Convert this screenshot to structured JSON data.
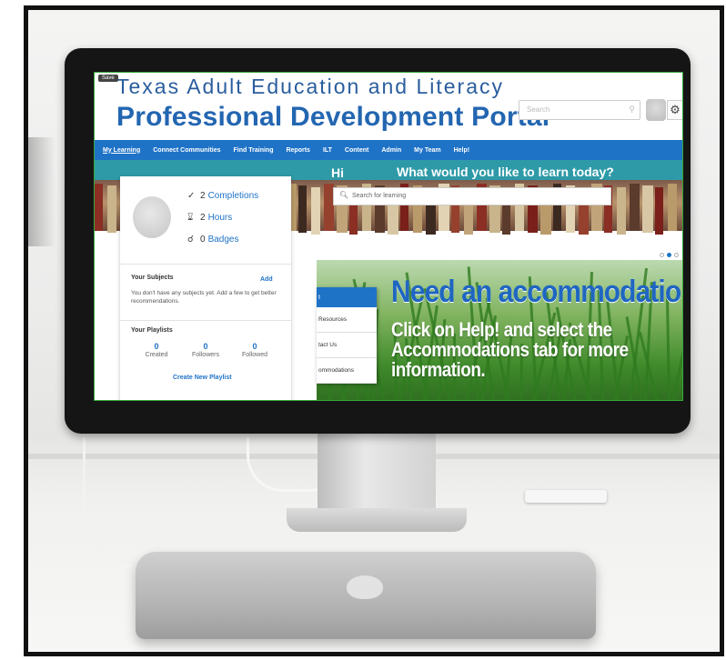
{
  "header": {
    "save_badge": "Save",
    "title_line1": "Texas Adult Education and Literacy",
    "title_line2": "Professional Development Portal",
    "search_placeholder": "Search"
  },
  "nav": {
    "items": [
      "My Learning",
      "Connect Communities",
      "Find Training",
      "Reports",
      "ILT",
      "Content",
      "Admin",
      "My Team",
      "Help!"
    ],
    "active_index": 0
  },
  "hero": {
    "greeting": "Hi",
    "question": "What would you like to learn today?",
    "search_placeholder": "Search for learning"
  },
  "profile": {
    "completions": {
      "count": "2",
      "label": "Completions",
      "icon": "check-circle-icon"
    },
    "hours": {
      "count": "2",
      "label": "Hours",
      "icon": "hourglass-icon"
    },
    "badges": {
      "count": "0",
      "label": "Badges",
      "icon": "ribbon-icon"
    },
    "subjects_heading": "Your Subjects",
    "subjects_add": "Add",
    "subjects_empty": "You don't have any subjects yet. Add a few to get better recommendations.",
    "playlists_heading": "Your Playlists",
    "playlist_stats": [
      {
        "value": "0",
        "label": "Created"
      },
      {
        "value": "0",
        "label": "Followers"
      },
      {
        "value": "0",
        "label": "Followed"
      }
    ],
    "create_playlist": "Create New Playlist"
  },
  "banner": {
    "headline": "Need an accommodation",
    "body": "Click on Help! and select the Accommodations tab for more information."
  },
  "help_menu": {
    "header": "t",
    "items": [
      "Resources",
      "tact Us",
      "ommodations"
    ]
  },
  "carousel": {
    "slides": 3,
    "active": 2
  },
  "colors": {
    "brand_blue": "#1f73c7",
    "title_blue": "#2366b1",
    "hero_teal": "#2e9aa7"
  }
}
